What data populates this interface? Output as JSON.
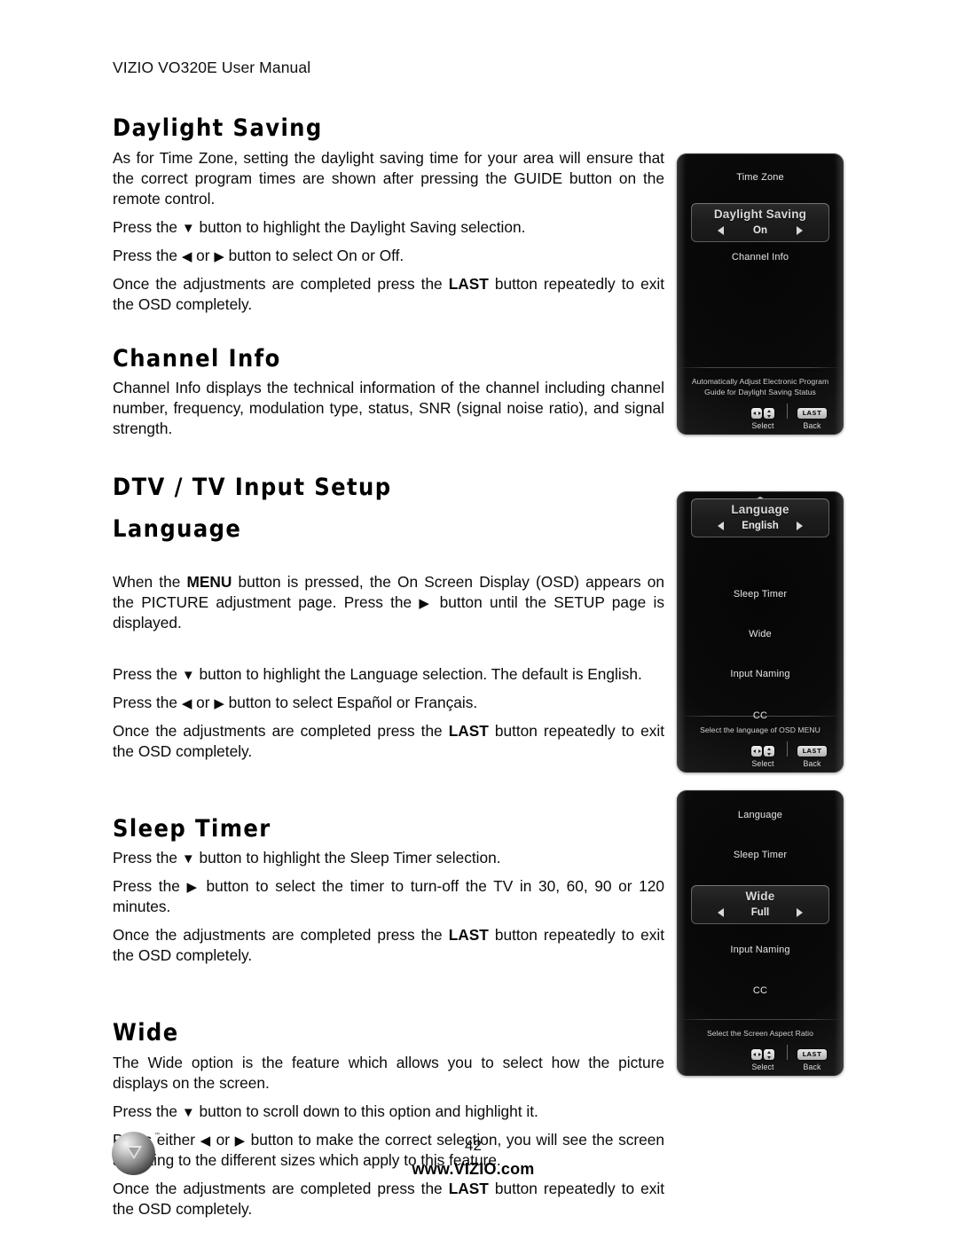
{
  "document": {
    "running_header": "VIZIO VO320E User Manual",
    "page_number": "42",
    "footer_url": "www.VIZIO.com",
    "logo_tm": "™"
  },
  "sections": [
    {
      "id": "daylight-saving",
      "title": "Daylight Saving",
      "paragraphs": [
        "As for Time Zone, setting the daylight saving time for your area will ensure that the correct program times are shown after pressing the GUIDE button on the remote control.",
        "Press the ▼ button to highlight the Daylight Saving selection.",
        "Press the ◀ or ▶ button to select On or Off.",
        "Once the adjustments are completed press the LAST button repeatedly to exit the OSD completely."
      ]
    },
    {
      "id": "channel-info",
      "title": "Channel Info",
      "paragraphs": [
        "Channel Info displays the technical information of the channel including channel number, frequency, modulation type, status, SNR (signal noise ratio), and signal strength."
      ]
    },
    {
      "id": "dtv-tv-input-setup",
      "title": "DTV / TV Input Setup",
      "paragraphs": []
    },
    {
      "id": "language",
      "title": "Language",
      "paragraphs": [
        "When the  MENU button is pressed, the On Screen Display (OSD) appears on the PICTURE adjustment page.  Press the ▶ button until the SETUP page is displayed.",
        "Press the ▼ button to highlight the Language selection.  The default is English.",
        "Press the ◀ or ▶ button to select Español or Français.",
        "Once the adjustments are completed press the LAST button repeatedly to exit the OSD completely."
      ]
    },
    {
      "id": "sleep-timer",
      "title": "Sleep Timer",
      "paragraphs": [
        "Press the ▼ button to highlight the Sleep Timer selection.",
        "Press the ▶ button to select the timer to turn-off the TV in 30, 60, 90 or 120 minutes.",
        "Once the adjustments are completed press the LAST button repeatedly to exit the OSD completely."
      ]
    },
    {
      "id": "wide",
      "title": "Wide",
      "paragraphs": [
        "The Wide option is the feature which allows you to select how the picture displays on the screen.",
        "Press the ▼ button to scroll down to this option and highlight it.",
        "Press either ◀ or ▶ button to make the correct selection, you will see the screen adjusting to the different sizes which apply to this feature.",
        "Once the adjustments are completed press the LAST button repeatedly to exit the OSD completely."
      ]
    }
  ],
  "text_runs": {
    "daylight_p1_a": "As for Time Zone, setting the daylight saving time for your area will ensure that the correct program times are shown after pressing the GUIDE button on the remote control.",
    "daylight_p2_a": "Press the ",
    "daylight_p2_b": " button to highlight the Daylight Saving selection.",
    "daylight_p3_a": "Press the ",
    "daylight_p3_b": " or ",
    "daylight_p3_c": " button to select On or Off.",
    "exit_a": "Once the adjustments are completed press the ",
    "exit_kw": "LAST",
    "exit_b": " button repeatedly to exit the OSD completely.",
    "channel_p1": "Channel Info displays the technical information of the channel including channel number, frequency, modulation type, status, SNR (signal noise ratio), and signal strength.",
    "lang_p1_a": "When the  ",
    "lang_p1_kw": "MENU",
    "lang_p1_b": " button is pressed, the On Screen Display (OSD) appears on the PICTURE adjustment page.  Press the ",
    "lang_p1_c": " button until the SETUP page is displayed.",
    "lang_p2_a": "Press the ",
    "lang_p2_b": " button to highlight the Language selection.  The default is English.",
    "lang_p3_a": "Press the ",
    "lang_p3_b": " or ",
    "lang_p3_c": " button to select Español or Français.",
    "sleep_p1_a": "Press the ",
    "sleep_p1_b": " button to highlight the Sleep Timer selection.",
    "sleep_p2_a": "Press the ",
    "sleep_p2_b": " button to select the timer to turn-off the TV in 30, 60, 90 or 120 minutes.",
    "wide_p1": "The Wide option is the feature which allows you to select how the picture displays on the screen.",
    "wide_p2_a": "Press the ",
    "wide_p2_b": " button to scroll down to this option and highlight it.",
    "wide_p3_a": "Press either ",
    "wide_p3_b": " or ",
    "wide_p3_c": " button to make the correct selection, you will see the screen adjusting to the different sizes which apply to this feature.",
    "arrow_down": "▼",
    "arrow_left": "◀",
    "arrow_right": "▶"
  },
  "osd_panels": [
    {
      "id": "daylight-saving-osd",
      "has_scroll_up": false,
      "items": [
        {
          "label": "Time Zone",
          "selected": false
        },
        {
          "label": "Daylight Saving",
          "selected": true,
          "value": "On"
        },
        {
          "label": "Channel Info",
          "selected": false
        }
      ],
      "hint_lines": [
        "Automatically Adjust Electronic Program",
        "Guide for Daylight Saving Status"
      ],
      "footer": {
        "select_label": "Select",
        "back_label": "Back",
        "back_key": "LAST"
      }
    },
    {
      "id": "language-osd",
      "has_scroll_up": true,
      "items": [
        {
          "label": "Language",
          "selected": true,
          "value": "English"
        },
        {
          "label": "Sleep Timer",
          "selected": false
        },
        {
          "label": "Wide",
          "selected": false
        },
        {
          "label": "Input Naming",
          "selected": false
        },
        {
          "label": "CC",
          "selected": false
        }
      ],
      "hint_lines": [
        "Select the language of OSD MENU"
      ],
      "footer": {
        "select_label": "Select",
        "back_label": "Back",
        "back_key": "LAST"
      }
    },
    {
      "id": "wide-osd",
      "has_scroll_up": false,
      "items": [
        {
          "label": "Language",
          "selected": false
        },
        {
          "label": "Sleep Timer",
          "selected": false
        },
        {
          "label": "Wide",
          "selected": true,
          "value": "Full"
        },
        {
          "label": "Input Naming",
          "selected": false
        },
        {
          "label": "CC",
          "selected": false
        }
      ],
      "hint_lines": [
        "Select the Screen Aspect Ratio"
      ],
      "footer": {
        "select_label": "Select",
        "back_label": "Back",
        "back_key": "LAST"
      }
    }
  ]
}
